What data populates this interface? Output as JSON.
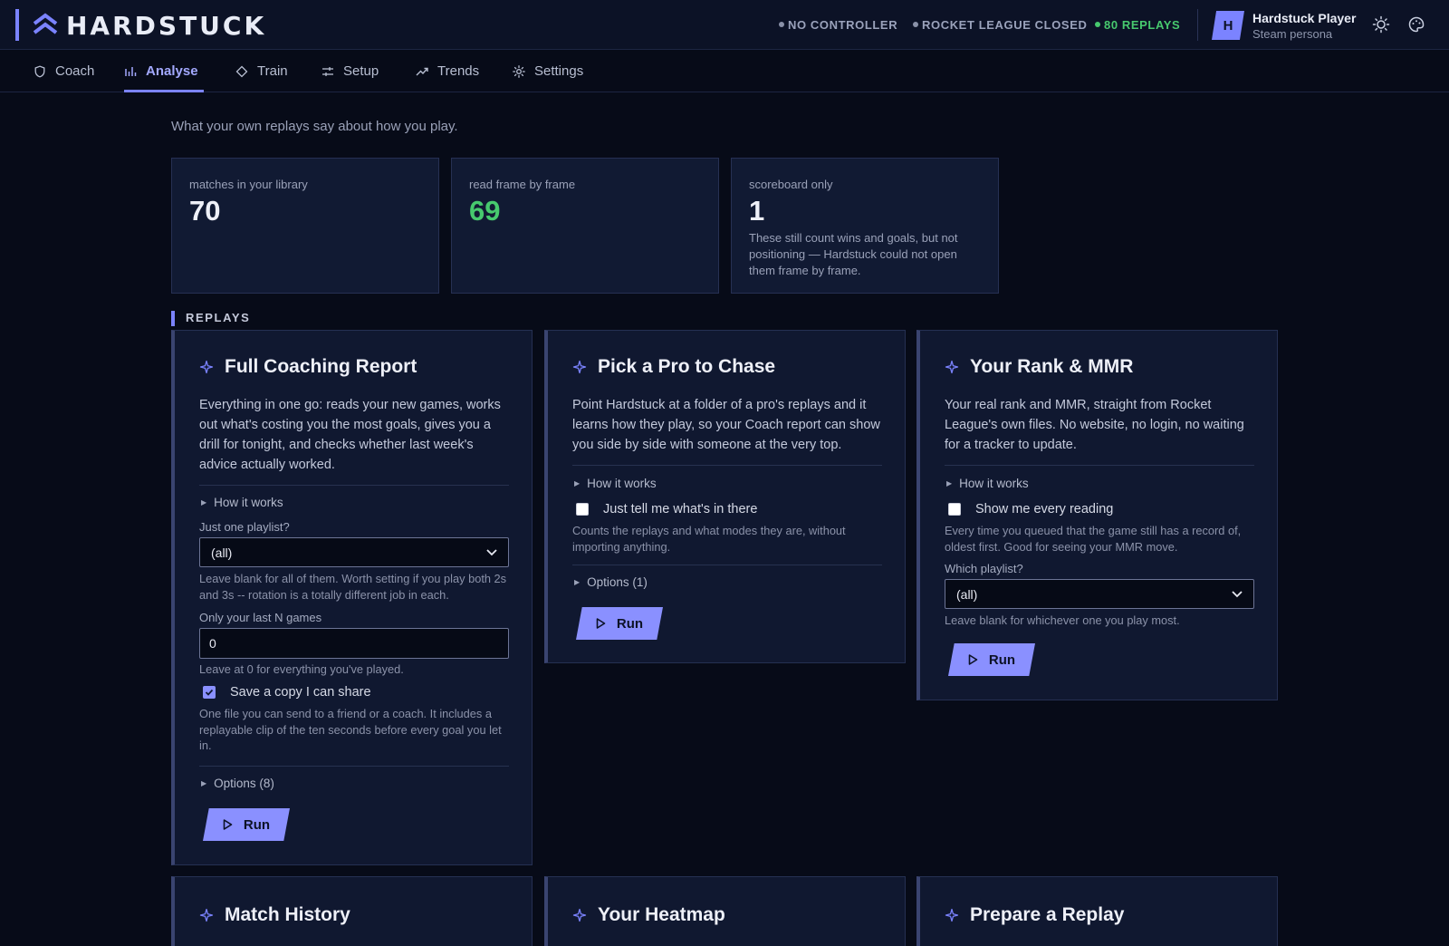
{
  "brand": {
    "name": "HARDSTUCK"
  },
  "header": {
    "statuses": [
      {
        "label": "NO CONTROLLER",
        "state": "off"
      },
      {
        "label": "ROCKET LEAGUE CLOSED",
        "state": "off"
      },
      {
        "label": "80 REPLAYS",
        "state": "ok"
      }
    ],
    "user": {
      "initial": "H",
      "name": "Hardstuck Player",
      "subtitle": "Steam persona"
    },
    "icons": [
      "sun-icon",
      "palette-icon"
    ]
  },
  "tabs": [
    {
      "label": "Coach",
      "icon": "shield-icon",
      "active": false
    },
    {
      "label": "Analyse",
      "icon": "bar-chart-icon",
      "active": true
    },
    {
      "label": "Train",
      "icon": "diamond-icon",
      "active": false
    },
    {
      "label": "Setup",
      "icon": "sliders-icon",
      "active": false
    },
    {
      "label": "Trends",
      "icon": "trend-up-icon",
      "active": false
    },
    {
      "label": "Settings",
      "icon": "gear-icon",
      "active": false
    }
  ],
  "intro": "What your own replays say about how you play.",
  "stats": [
    {
      "label": "matches in your library",
      "value": "70"
    },
    {
      "label": "read frame by frame",
      "value": "69"
    },
    {
      "label": "scoreboard only",
      "value": "1",
      "note": "These still count wins and goals, but not positioning — Hardstuck could not open them frame by frame."
    }
  ],
  "section": {
    "title": "REPLAYS"
  },
  "cards": {
    "coaching": {
      "title": "Full Coaching Report",
      "description": "Everything in one go: reads your new games, works out what's costing you the most goals, gives you a drill for tonight, and checks whether last week's advice actually worked.",
      "how_it_works": "How it works",
      "playlist_label": "Just one playlist?",
      "playlist_value": "(all)",
      "playlist_hint": "Leave blank for all of them. Worth setting if you play both 2s and 3s -- rotation is a totally different job in each.",
      "lastn_label": "Only your last N games",
      "lastn_value": "0",
      "lastn_hint": "Leave at 0 for everything you've played.",
      "share_label": "Save a copy I can share",
      "share_checked": true,
      "share_hint": "One file you can send to a friend or a coach. It includes a replayable clip of the ten seconds before every goal you let in.",
      "options": "Options (8)",
      "run": "Run"
    },
    "pro": {
      "title": "Pick a Pro to Chase",
      "description": "Point Hardstuck at a folder of a pro's replays and it learns how they play, so your Coach report can show you side by side with someone at the very top.",
      "how_it_works": "How it works",
      "check_label": "Just tell me what's in there",
      "check_checked": false,
      "check_hint": "Counts the replays and what modes they are, without importing anything.",
      "options": "Options (1)",
      "run": "Run"
    },
    "rank": {
      "title": "Your Rank & MMR",
      "description": "Your real rank and MMR, straight from Rocket League's own files. No website, no login, no waiting for a tracker to update.",
      "how_it_works": "How it works",
      "check_label": "Show me every reading",
      "check_checked": false,
      "check_hint": "Every time you queued that the game still has a record of, oldest first. Good for seeing your MMR move.",
      "playlist_label": "Which playlist?",
      "playlist_value": "(all)",
      "playlist_hint": "Leave blank for whichever one you play most.",
      "run": "Run"
    },
    "history": {
      "title": "Match History"
    },
    "heatmap": {
      "title": "Your Heatmap"
    },
    "prepare": {
      "title": "Prepare a Replay"
    }
  },
  "colors": {
    "accent": "#7b83ff",
    "ok": "#47c96e",
    "background": "#070b18",
    "card": "#101830"
  }
}
